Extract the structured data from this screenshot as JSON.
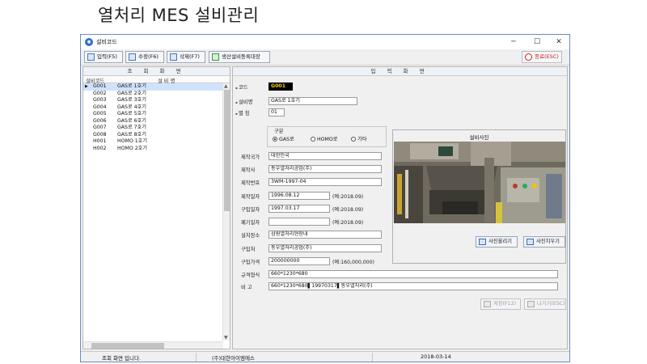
{
  "heading": "열처리 MES 설비관리",
  "window": {
    "title": "설비코드",
    "icon": "app-logo-icon",
    "controls": {
      "minimize": "─",
      "maximize": "☐",
      "close": "✕"
    }
  },
  "toolbar": {
    "input_label": "입력(F5)",
    "edit_label": "수정(F6)",
    "delete_label": "삭제(F7)",
    "register_label": "생산설비등록대장",
    "exit_label": "종료(ESC)"
  },
  "list_panel": {
    "header": "조 회 화 면",
    "columns": [
      "설비코드",
      "설 비 명"
    ],
    "rows": [
      {
        "code": "G001",
        "name": "GAS로 1호기",
        "selected": true
      },
      {
        "code": "G002",
        "name": "GAS로 2호기"
      },
      {
        "code": "G003",
        "name": "GAS로 3호기"
      },
      {
        "code": "G004",
        "name": "GAS로 4호기"
      },
      {
        "code": "G005",
        "name": "GAS로 5호기"
      },
      {
        "code": "G006",
        "name": "GAS로 6호기"
      },
      {
        "code": "G007",
        "name": "GAS로 7호기"
      },
      {
        "code": "G008",
        "name": "GAS로 8호기"
      },
      {
        "code": "H001",
        "name": "HOMO 1호기"
      },
      {
        "code": "H002",
        "name": "HOMO 2호기"
      }
    ]
  },
  "form": {
    "header": "입 력 화 면",
    "code_label": "코드",
    "code_value": "G001",
    "name_label": "설비명",
    "name_value": "GAS로 1호기",
    "alias_label": "별 칭",
    "alias_value": "01",
    "type_group_label": "구분",
    "type_options": [
      "GAS로",
      "HOMO로",
      "기타"
    ],
    "type_selected": 0,
    "country_label": "제작국가",
    "country_value": "대한민국",
    "maker_label": "제작사",
    "maker_value": "동우열처리공업(주)",
    "serial_label": "제작번호",
    "serial_value": "3WM-1997-04",
    "made_date_label": "제작일자",
    "made_date_value": "1996.08.12",
    "made_date_hint": "(예:2018.09)",
    "buy_date_label": "구입일자",
    "buy_date_value": "1997.03.17",
    "buy_date_hint": "(예:2018.09)",
    "discard_date_label": "폐기일자",
    "discard_date_value": "",
    "discard_date_hint": "(예:2018.09)",
    "location_label": "설치장소",
    "location_value": "삼원열처리현장내",
    "vendor_label": "구입처",
    "vendor_value": "동우열처리공업(주)",
    "price_label": "구입가격",
    "price_value": "200000000",
    "price_hint": "(예:160,000,000)",
    "spec_label": "규격형식",
    "spec_value": "660*1230*680",
    "remark_label": "비 고",
    "remark_value": "660*1230*680▌19970317▌동우열처리(주)"
  },
  "photo": {
    "title": "설비사진",
    "upload_label": "사진올리기",
    "delete_label": "사진지우기"
  },
  "actions": {
    "save_label": "저장(F12)",
    "exit_label": "나가기(ESC)"
  },
  "statusbar": {
    "message": "조회 화면 입니다.",
    "company": "(주)대한아이엠에스",
    "date": "2018-03-14"
  },
  "colors": {
    "selection": "#cfe2fb",
    "code_field_bg": "#000000",
    "code_field_text": "#ffd400",
    "exit_red": "#d41b1b"
  }
}
